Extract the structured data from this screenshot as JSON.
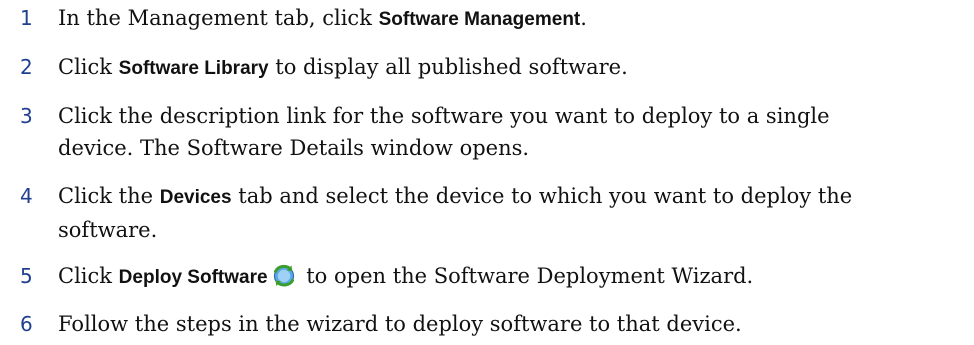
{
  "steps": [
    {
      "num": "1",
      "pre": "In the Management tab, click ",
      "ui": "Software Management",
      "post": "."
    },
    {
      "num": "2",
      "pre": "Click ",
      "ui": "Software Library",
      "post": " to display all published software."
    },
    {
      "num": "3",
      "line1": "Click the description link for the software you want to deploy to a single",
      "line2": "device. The Software Details window opens."
    },
    {
      "num": "4",
      "pre": "Click the ",
      "ui": "Devices",
      "post": " tab and select the device to which you want to deploy the",
      "line2": "software."
    },
    {
      "num": "5",
      "pre": "Click ",
      "ui": "Deploy Software",
      "post": " to open the Software Deployment Wizard.",
      "icon": "deploy-software-icon"
    },
    {
      "num": "6",
      "text": "Follow the steps in the wizard to deploy software to that device."
    }
  ]
}
